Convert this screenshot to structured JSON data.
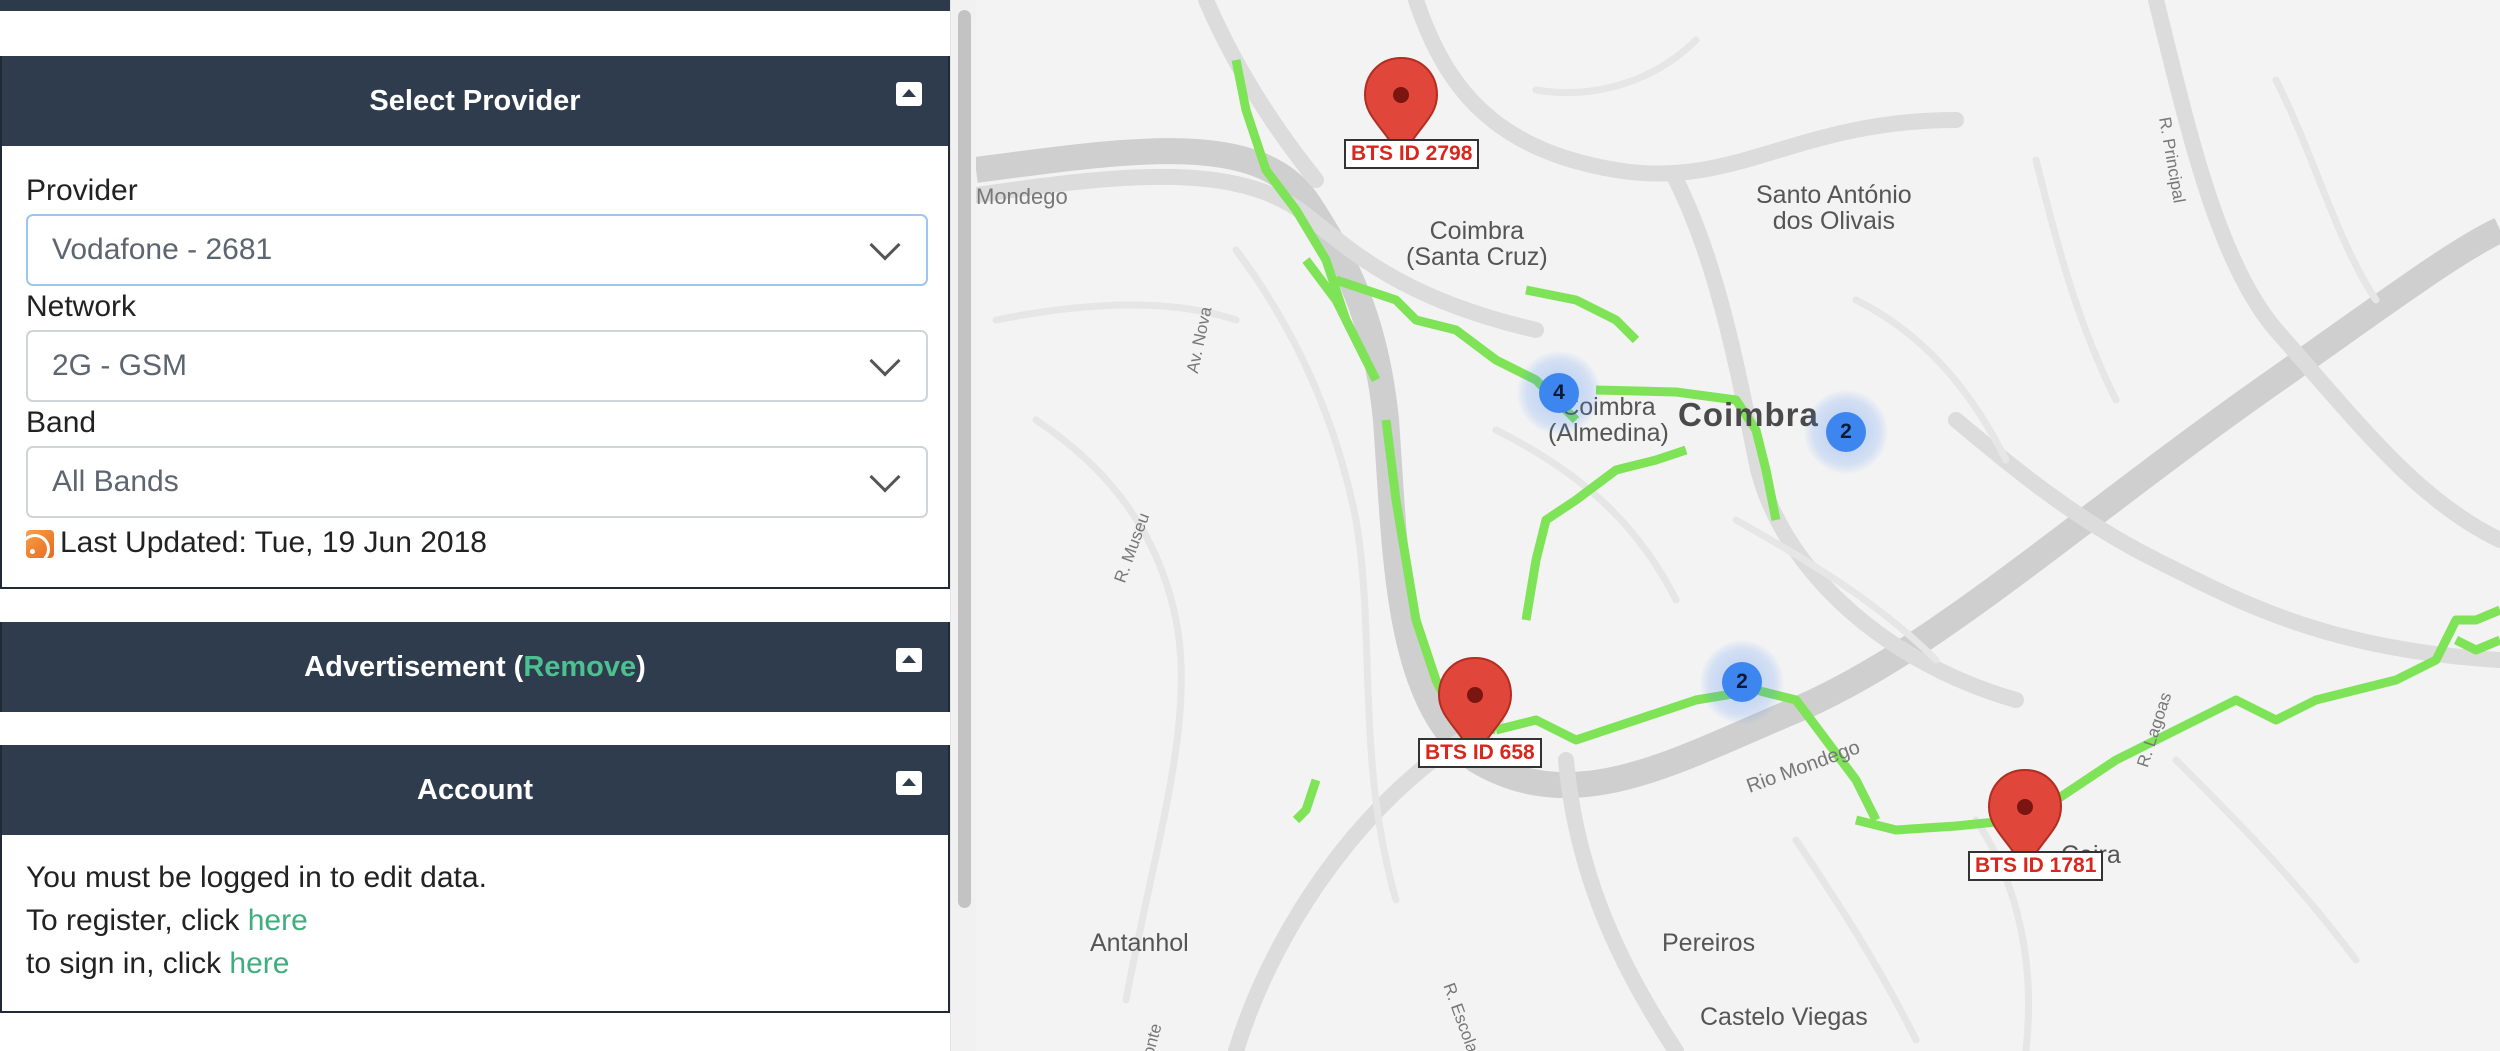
{
  "sidebar": {
    "provider_panel": {
      "title": "Select Provider",
      "provider": {
        "label": "Provider",
        "value": "Vodafone - 2681"
      },
      "network": {
        "label": "Network",
        "value": "2G - GSM"
      },
      "band": {
        "label": "Band",
        "value": "All Bands"
      },
      "last_updated": "Last Updated: Tue, 19 Jun 2018"
    },
    "ad_panel": {
      "title_prefix": "Advertisement (",
      "remove_link": "Remove",
      "title_suffix": ")"
    },
    "account_panel": {
      "title": "Account",
      "line1": "You must be logged in to edit data.",
      "line2_prefix": "To register, click ",
      "line2_link": "here",
      "line3_prefix": "to sign in, click ",
      "line3_link": "here"
    }
  },
  "map": {
    "places": {
      "coimbra": "Coimbra",
      "santa_cruz": "Coimbra\n(Santa Cruz)",
      "almedina": "Coimbra\n(Almedina)",
      "santo_antonio": "Santo António\ndos Olivais",
      "antanhol": "Antanhol",
      "pereiros": "Pereiros",
      "castelo_viegas": "Castelo Viegas",
      "ceira": "Ceira",
      "mondego_left": "Mondego",
      "rio_mondego": "Rio Mondego"
    },
    "streets": {
      "av_nova": "Av. Nova",
      "r_museu": "R. Museu",
      "r_principal": "R. Principal",
      "r_lagoas": "R. Lagoas",
      "r_escola": "R. Escola",
      "conte": "onte"
    },
    "markers": [
      {
        "label": "BTS ID 2798"
      },
      {
        "label": "BTS ID 658"
      },
      {
        "label": "BTS ID 1781"
      }
    ],
    "clusters": [
      {
        "count": "4"
      },
      {
        "count": "2"
      },
      {
        "count": "2"
      }
    ],
    "colors": {
      "coverage": "#7ee356",
      "marker": "#e0463a",
      "cluster": "#3d86f0"
    }
  }
}
